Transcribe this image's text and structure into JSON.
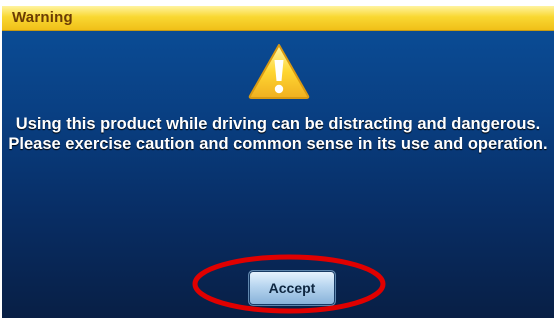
{
  "dialog": {
    "title": "Warning",
    "icon": "warning-triangle-icon",
    "message_line1": "Using this product while driving can be distracting and dangerous.",
    "message_line2": "Please exercise caution and common sense in its use and operation.",
    "accept_label": "Accept"
  },
  "colors": {
    "titlebar": "#f9d832",
    "dialog_background": "#093f82",
    "message_text": "#ffffff",
    "annotation_ring": "#e00000"
  }
}
